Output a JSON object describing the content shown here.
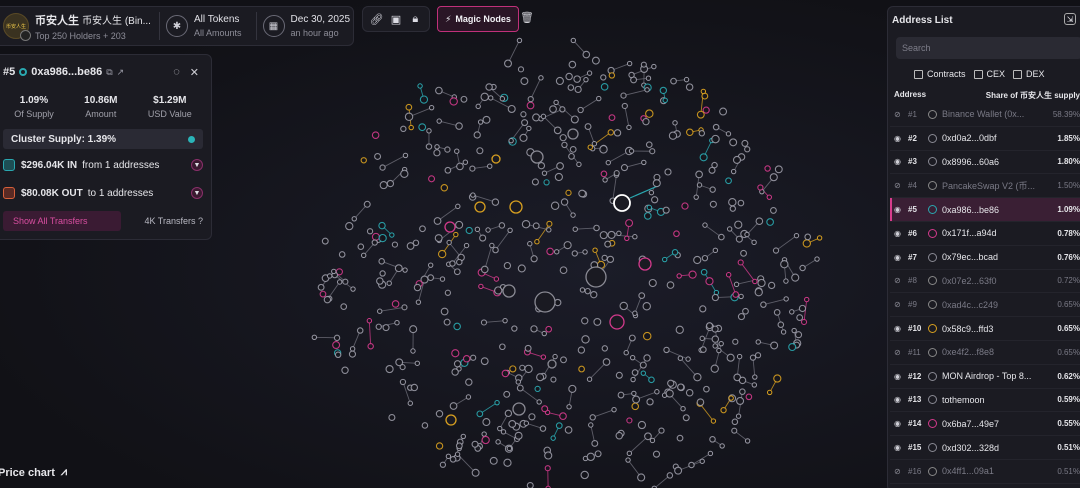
{
  "token": {
    "name": "币安人生",
    "name_sub": "币安人生 (Bin...",
    "logo_text": "币安人生",
    "holders": "Top 250 Holders + 203",
    "amount_filter": "All Tokens",
    "amount_sub": "All Amounts",
    "date": "Dec 30, 2025",
    "date_sub": "an hour ago"
  },
  "toolbar": {
    "magic_nodes": "Magic Nodes"
  },
  "holder_card": {
    "rank": "#5",
    "address": "0xa986...be86",
    "stats": [
      {
        "value": "1.09%",
        "label": "Of Supply"
      },
      {
        "value": "10.86M",
        "label": "Amount"
      },
      {
        "value": "$1.29M",
        "label": "USD Value"
      }
    ],
    "cluster_supply": "Cluster Supply: 1.39%",
    "flow_in_amount": "$296.04K IN",
    "flow_in_from": "from 1 addresses",
    "flow_out_amount": "$80.08K OUT",
    "flow_out_to": "to 1 addresses",
    "show_transfers": "Show All Transfers",
    "transfer_count": "4K Transfers"
  },
  "price_chart": "Price chart",
  "address_list": {
    "title": "Address List",
    "search_placeholder": "Search",
    "filters": [
      "Contracts",
      "CEX",
      "DEX"
    ],
    "col_address": "Address",
    "col_share": "Share of 币安人生 supply",
    "rows": [
      {
        "rank": "#1",
        "name": "Binance Wallet (0x...",
        "share": "58.39%",
        "dim": true,
        "color": "#888888"
      },
      {
        "rank": "#2",
        "name": "0xd0a2...0dbf",
        "share": "1.85%",
        "dim": false,
        "color": "#8a8a94"
      },
      {
        "rank": "#3",
        "name": "0x8996...60a6",
        "share": "1.80%",
        "dim": false,
        "color": "#8a8a94"
      },
      {
        "rank": "#4",
        "name": "PancakeSwap V2 (币...",
        "share": "1.50%",
        "dim": true,
        "color": "#888888"
      },
      {
        "rank": "#5",
        "name": "0xa986...be86",
        "share": "1.09%",
        "dim": false,
        "color": "#2aa8b0",
        "selected": true
      },
      {
        "rank": "#6",
        "name": "0x171f...a94d",
        "share": "0.78%",
        "dim": false,
        "color": "#d33a8c"
      },
      {
        "rank": "#7",
        "name": "0x79ec...bcad",
        "share": "0.76%",
        "dim": false,
        "color": "#8a8a94"
      },
      {
        "rank": "#8",
        "name": "0x07e2...63f0",
        "share": "0.72%",
        "dim": true,
        "color": "#888888"
      },
      {
        "rank": "#9",
        "name": "0xad4c...c249",
        "share": "0.65%",
        "dim": true,
        "color": "#888888"
      },
      {
        "rank": "#10",
        "name": "0x58c9...ffd3",
        "share": "0.65%",
        "dim": false,
        "color": "#d8a020"
      },
      {
        "rank": "#11",
        "name": "0xe4f2...f8e8",
        "share": "0.65%",
        "dim": true,
        "color": "#888888"
      },
      {
        "rank": "#12",
        "name": "MON Airdrop - Top 8...",
        "share": "0.62%",
        "dim": false,
        "color": "#8a8a94"
      },
      {
        "rank": "#13",
        "name": "tothemoon",
        "share": "0.59%",
        "dim": false,
        "color": "#8a8a94"
      },
      {
        "rank": "#14",
        "name": "0x6ba7...49e7",
        "share": "0.55%",
        "dim": false,
        "color": "#d33a8c"
      },
      {
        "rank": "#15",
        "name": "0xd302...328d",
        "share": "0.51%",
        "dim": false,
        "color": "#8a8a94"
      },
      {
        "rank": "#16",
        "name": "0x4ff1...09a1",
        "share": "0.51%",
        "dim": true,
        "color": "#888888"
      }
    ]
  },
  "colors": {
    "accent": "#d33a8c",
    "teal": "#2aa8b0",
    "gold": "#d8a020",
    "node": "#9a9aa6"
  }
}
